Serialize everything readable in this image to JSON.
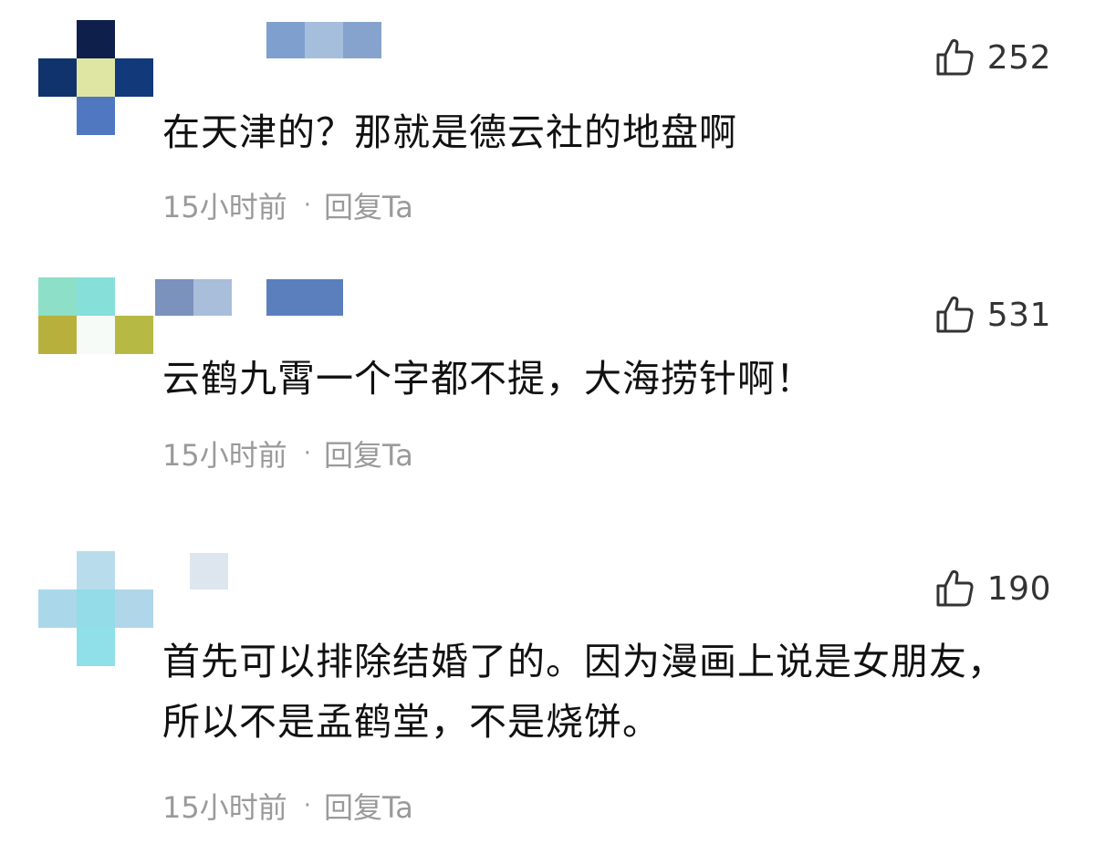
{
  "comments": [
    {
      "text": "在天津的？那就是德云社的地盘啊",
      "likes": "252",
      "time": "15小时前",
      "separator": "·",
      "reply_label": "回复Ta",
      "like_icon": "thumbs-up-icon"
    },
    {
      "text": "云鹤九霄一个字都不提，大海捞针啊！",
      "likes": "531",
      "time": "15小时前",
      "separator": "·",
      "reply_label": "回复Ta",
      "like_icon": "thumbs-up-icon"
    },
    {
      "text": "首先可以排除结婚了的。因为漫画上说是女朋友，所以不是孟鹤堂，不是烧饼。",
      "likes": "190",
      "time": "15小时前",
      "separator": "·",
      "reply_label": "回复Ta",
      "like_icon": "thumbs-up-icon"
    }
  ],
  "colors": {
    "text": "#111111",
    "meta": "#9a9a9a",
    "like_count": "#333333",
    "avatar1": [
      "#0d1f4a",
      "#11336b",
      "#dfe6a4",
      "#12397a",
      "#4f78c0"
    ],
    "name1": [
      "#7f9fcf",
      "#a5bedb",
      "#86a3ce"
    ],
    "avatar2": [
      "#8ddfc8",
      "#86dfd9",
      "#b8b03d",
      "#f7fbf7",
      "#b6ba45"
    ],
    "name2": [
      "#7a92bc",
      "#a8bedb",
      "#5b7fbd"
    ],
    "avatar3": [
      "#b9dcec",
      "#aad8ea",
      "#94dce8",
      "#b0d6ea",
      "#8fe0e8"
    ],
    "name3": [
      "#dde6ef"
    ]
  }
}
